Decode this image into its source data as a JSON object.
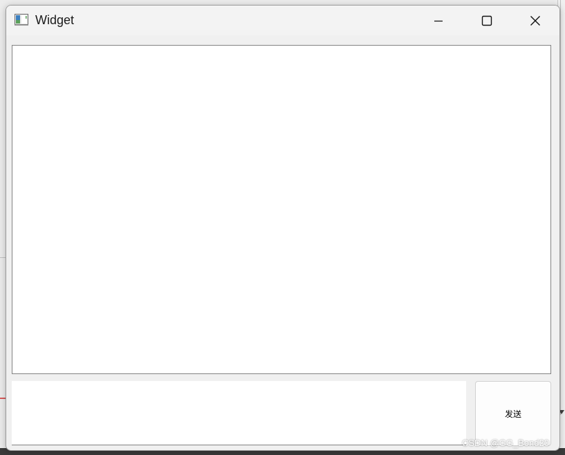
{
  "window": {
    "title": "Widget",
    "icon": "qt-widget-app-icon",
    "controls": {
      "minimize": "minimize-icon",
      "maximize": "maximize-icon",
      "close": "close-icon"
    }
  },
  "chat": {
    "display_text": "",
    "input_value": "",
    "send_label": "发送"
  },
  "watermark": {
    "text": "CSDN @GG_Bond20"
  },
  "colors": {
    "titlebar": "#f3f3f3",
    "window_bg": "#f0f0f0",
    "border": "#828282"
  }
}
